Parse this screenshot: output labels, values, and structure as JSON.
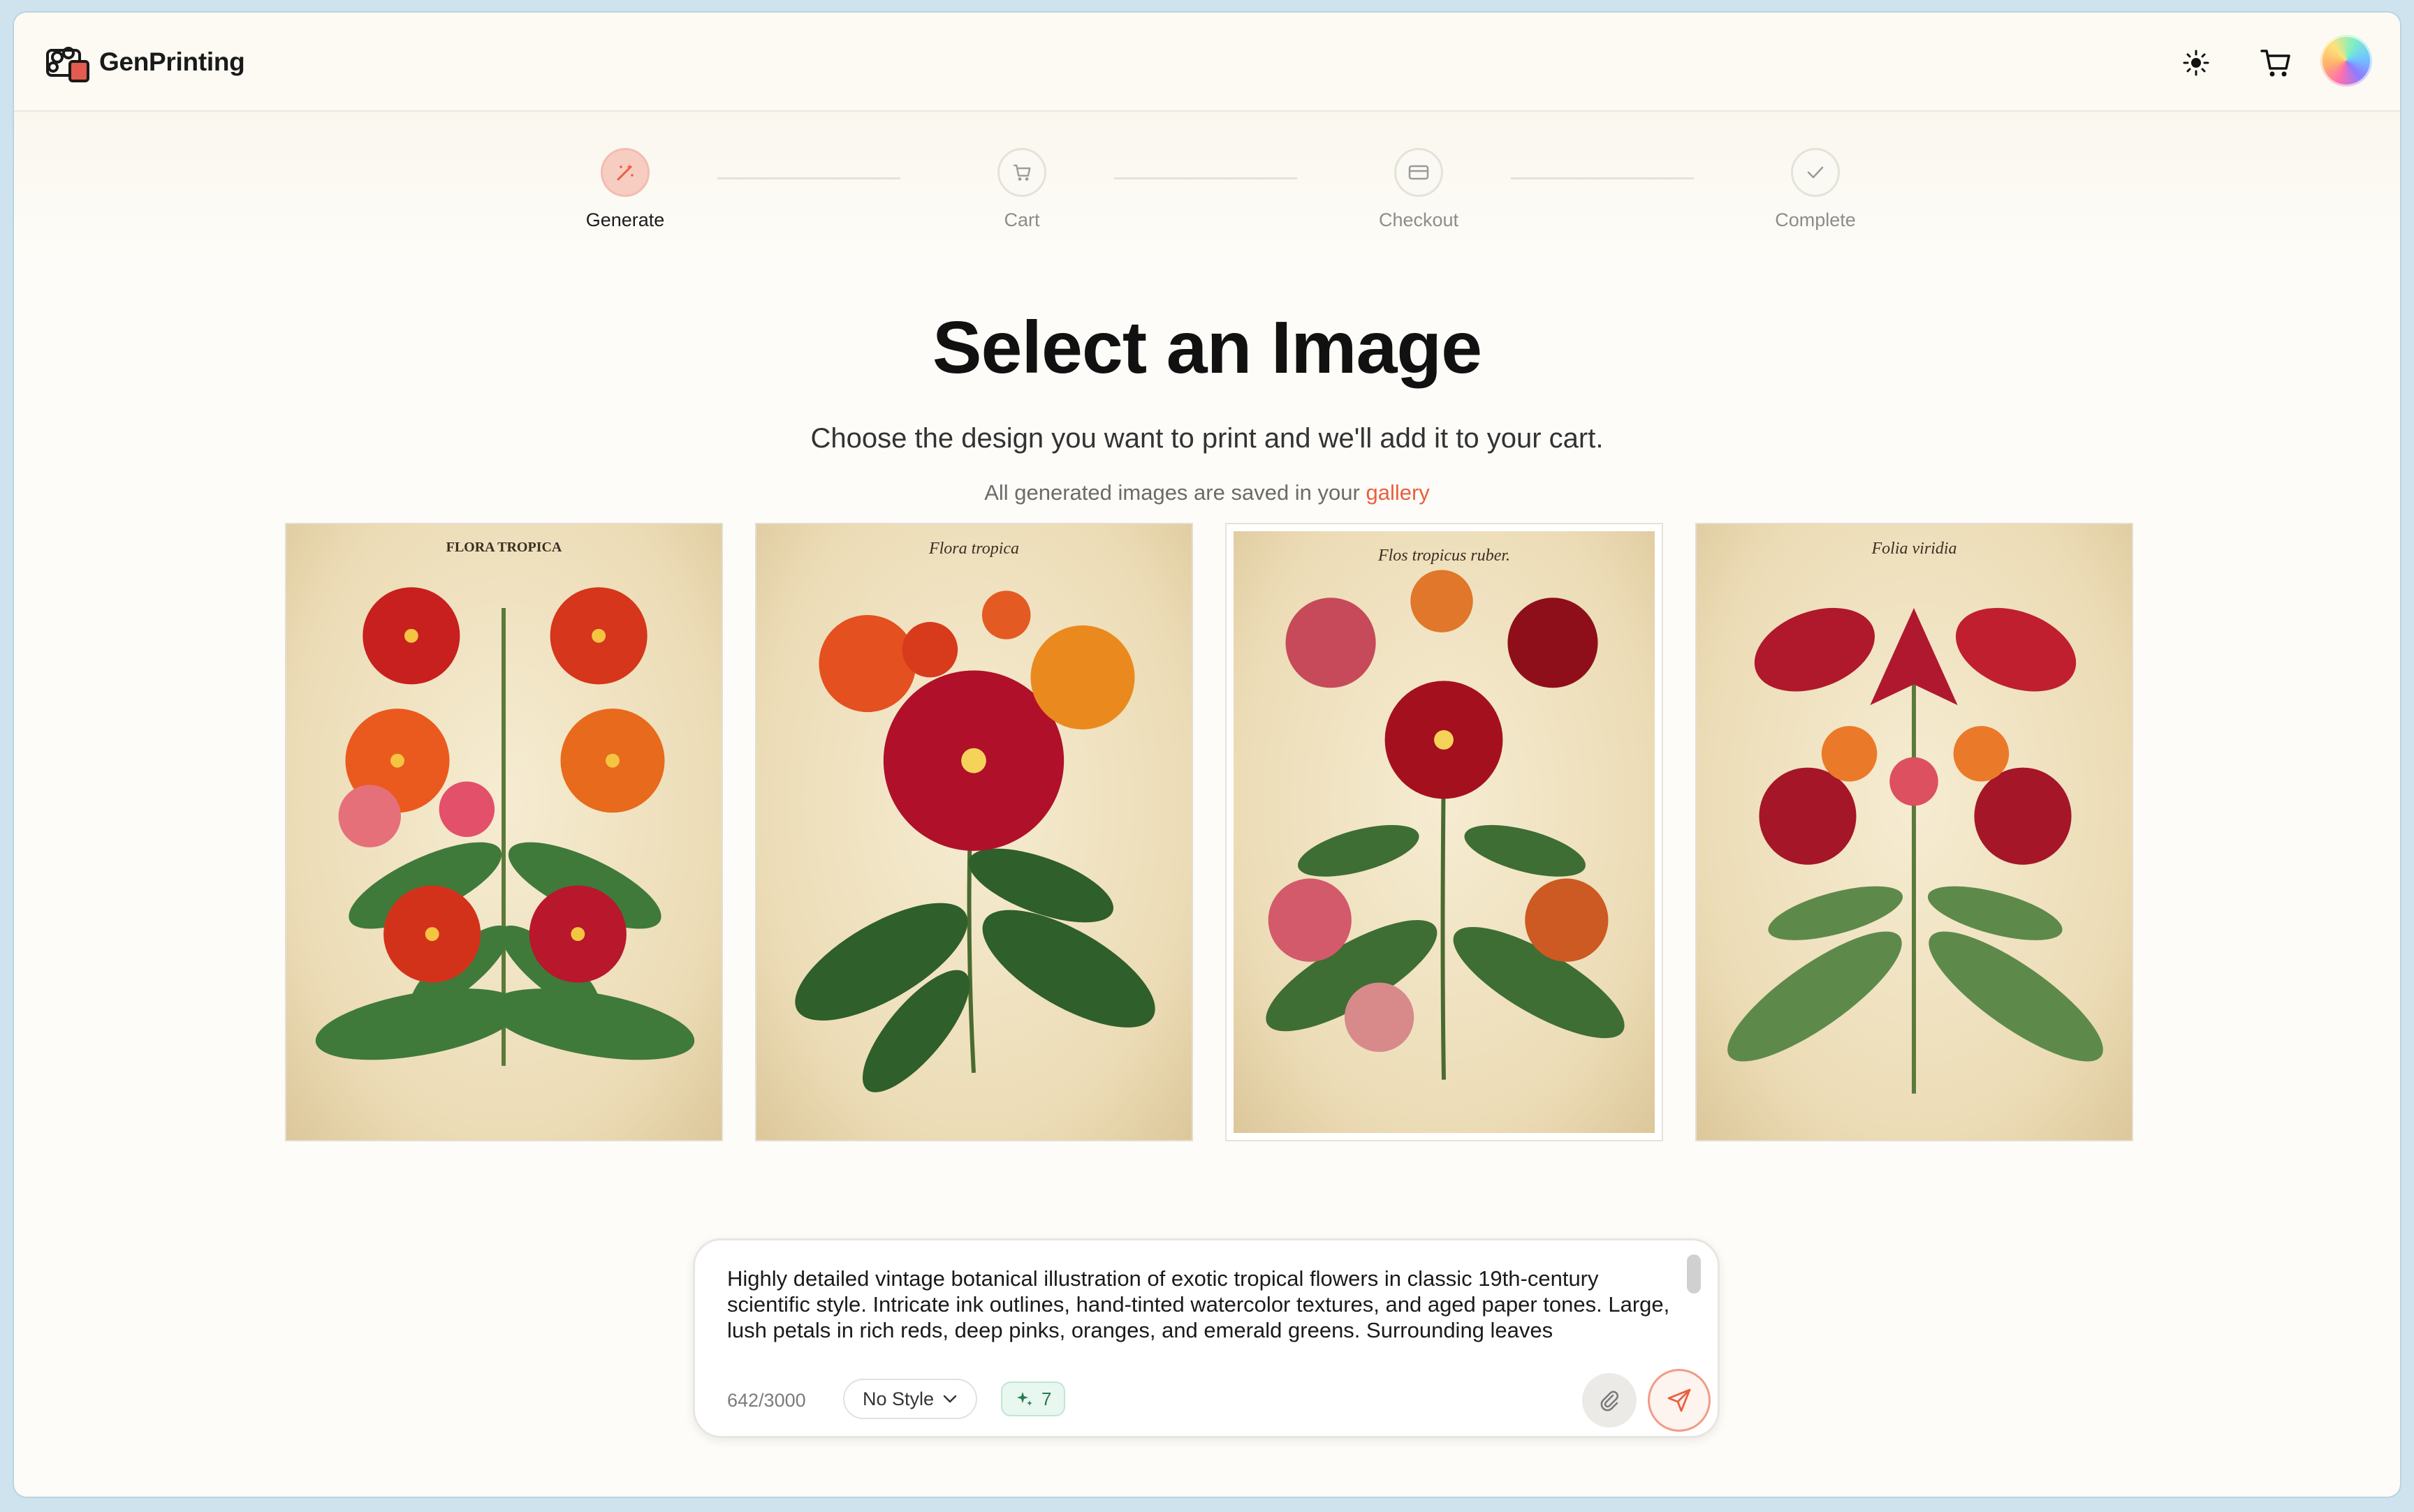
{
  "app": {
    "name": "GenPrinting"
  },
  "header": {
    "icons": [
      "sun-icon",
      "cart-icon"
    ],
    "avatar": "avatar"
  },
  "steps": [
    {
      "label": "Generate",
      "icon": "magic-wand-icon",
      "active": true
    },
    {
      "label": "Cart",
      "icon": "cart-icon",
      "active": false
    },
    {
      "label": "Checkout",
      "icon": "credit-card-icon",
      "active": false
    },
    {
      "label": "Complete",
      "icon": "check-icon",
      "active": false
    }
  ],
  "main": {
    "title": "Select an Image",
    "subtitle": "Choose the design you want to print and we'll add it to your cart.",
    "note_prefix": "All generated images are saved in your ",
    "note_link": "gallery"
  },
  "gallery": {
    "images": [
      {
        "plate_title": "FLORA TROPICA",
        "selected": false
      },
      {
        "plate_title": "Flora tropica",
        "selected": false
      },
      {
        "plate_title": "Flos tropicus ruber.",
        "selected": true
      },
      {
        "plate_title": "Folia viridia",
        "selected": false
      }
    ]
  },
  "composer": {
    "prompt": "Highly detailed vintage botanical illustration of exotic tropical flowers in classic 19th-century scientific style. Intricate ink outlines, hand-tinted watercolor textures, and aged paper tones. Large, lush petals in rich reds, deep pinks, oranges, and emerald greens. Surrounding leaves",
    "counter": "642/3000",
    "style_label": "No Style",
    "badge_count": "7"
  },
  "colors": {
    "accent": "#e9603f",
    "badge_green": "#2a7a52",
    "step_active": "#f7cdc2"
  }
}
